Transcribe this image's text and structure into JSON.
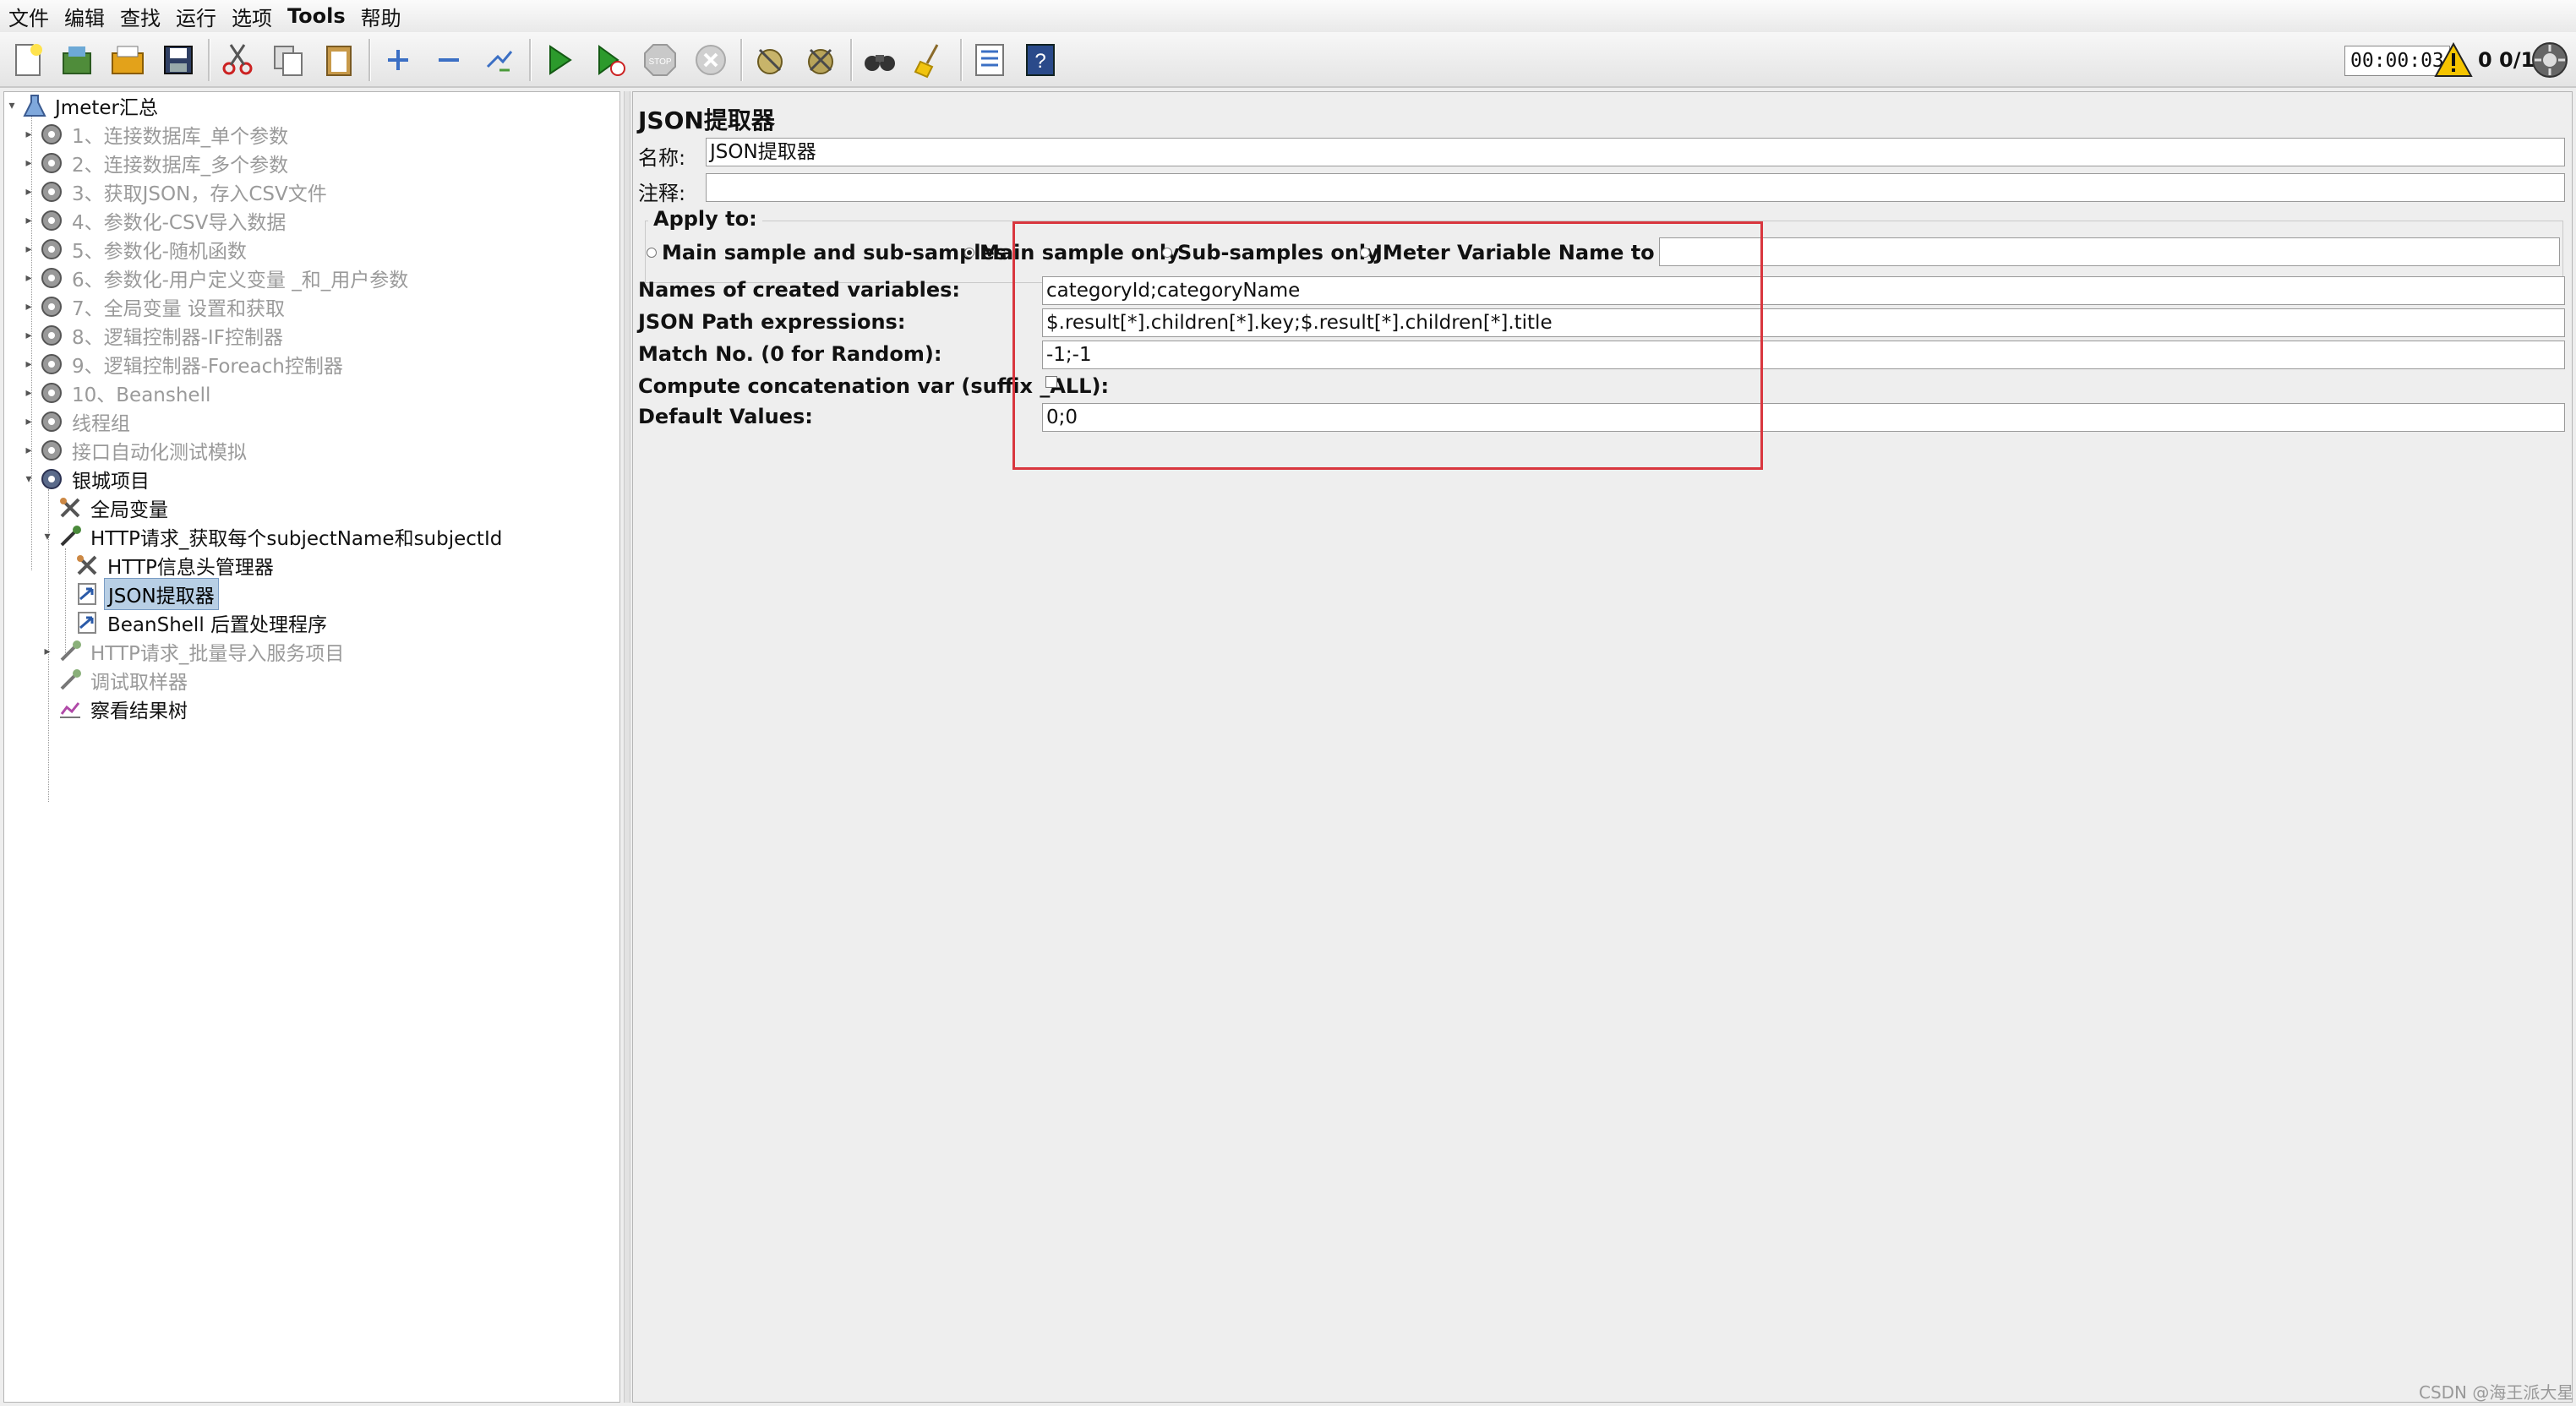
{
  "menubar": {
    "items": [
      "文件",
      "编辑",
      "查找",
      "运行",
      "选项",
      "Tools",
      "帮助"
    ]
  },
  "toolbar": {
    "buttons": [
      "new-icon",
      "templates-icon",
      "open-icon",
      "save-icon",
      "cut-icon",
      "copy-icon",
      "paste-icon",
      "expand-icon",
      "collapse-icon",
      "toggle-icon",
      "start-icon",
      "start-no-pause-icon",
      "stop-icon",
      "shutdown-icon",
      "clear-icon",
      "clear-all-icon",
      "search-icon",
      "reset-search-icon",
      "function-helper-icon",
      "help-icon"
    ],
    "timer": "00:00:03",
    "counts": "0 0/1"
  },
  "tree": {
    "root": "Jmeter汇总",
    "items": [
      "1、连接数据库_单个参数",
      "2、连接数据库_多个参数",
      "3、获取JSON，存入CSV文件",
      "4、参数化-CSV导入数据",
      "5、参数化-随机函数",
      "6、参数化-用户定义变量 _和_用户参数",
      "7、全局变量  设置和获取",
      "8、逻辑控制器-IF控制器",
      "9、逻辑控制器-Foreach控制器",
      "10、Beanshell",
      "线程组",
      "接口自动化测试模拟",
      "银城项目",
      "全局变量",
      "HTTP请求_获取每个subjectName和subjectId",
      "HTTP信息头管理器",
      "JSON提取器",
      "BeanShell 后置处理程序",
      "HTTP请求_批量导入服务项目",
      "调试取样器",
      "察看结果树"
    ]
  },
  "panel": {
    "title": "JSON提取器",
    "name_label": "名称:",
    "name_value": "JSON提取器",
    "comment_label": "注释:",
    "comment_value": "",
    "apply_to_label": "Apply to:",
    "apply_options": [
      "Main sample and sub-samples",
      "Main sample only",
      "Sub-samples only",
      "JMeter Variable Name to use"
    ],
    "apply_selected": "Main sample only",
    "var_name_value": "",
    "names_label": "Names of created variables:",
    "names_value": "categoryId;categoryName",
    "paths_label": "JSON Path expressions:",
    "paths_value": "$.result[*].children[*].key;$.result[*].children[*].title",
    "match_label": "Match No. (0 for Random):",
    "match_value": "-1;-1",
    "concat_label": "Compute concatenation var (suffix _ALL):",
    "default_label": "Default Values:",
    "default_value": "0;0"
  },
  "watermark": "CSDN @海王派大星",
  "colors": {
    "highlight": "#d9363e",
    "selection": "#b8cfe5"
  }
}
